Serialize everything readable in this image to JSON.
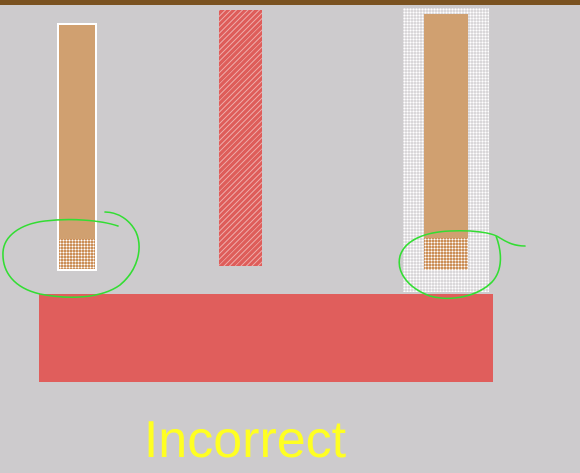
{
  "caption": {
    "text": "Incorrect",
    "color": "#ffff22"
  },
  "colors": {
    "background": "#cdcbcd",
    "top_bar": "#7a5220",
    "tan_bar": "#d0a070",
    "red_bar": "#de5d5a",
    "base_bar": "#e05e5c",
    "annotation_stroke": "#33dd33"
  }
}
